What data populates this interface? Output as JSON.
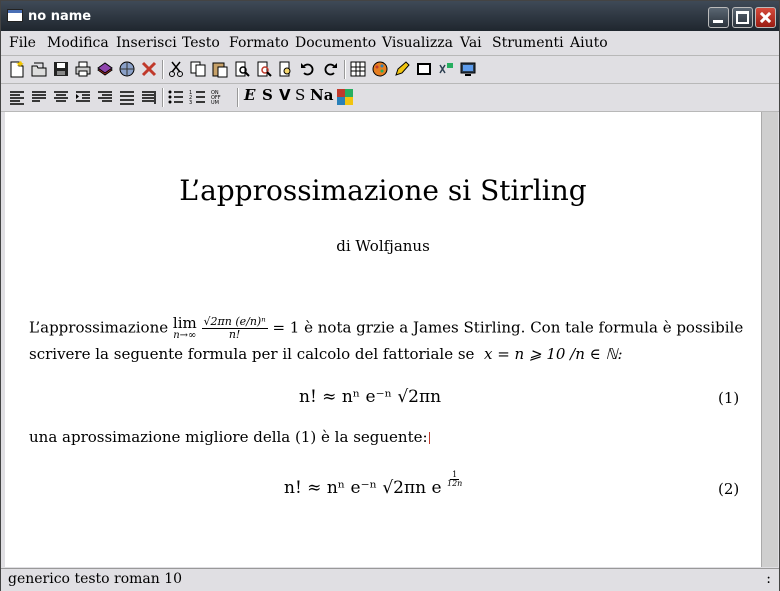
{
  "window": {
    "title": "no name"
  },
  "menu": [
    "File",
    "Modifica",
    "Inserisci",
    "Testo",
    "Formato",
    "Documento",
    "Visualizza",
    "Vai",
    "Strumenti",
    "Aiuto"
  ],
  "toolbar_icons": [
    "new-file-icon",
    "open-file-icon",
    "save-icon",
    "print-icon",
    "export-icon",
    "globe-icon",
    "close-doc-icon",
    "cut-icon",
    "copy-icon",
    "paste-icon",
    "find-icon",
    "replace-icon",
    "preview-icon",
    "undo-icon",
    "redo-icon",
    "table-icon",
    "paint-icon",
    "pen-icon",
    "frame-icon",
    "math-icon",
    "monitor-icon"
  ],
  "format_toolbar": {
    "emph": "E",
    "bold": "S",
    "sans": "V",
    "smallcaps": "S",
    "noun": "Na"
  },
  "document": {
    "title": "L’approssimazione si Stirling",
    "author": "di Wolfjanus",
    "para1_start": "L’approssimazione",
    "para1_lim": "lim",
    "para1_lim_sub": "n→∞",
    "para1_frac_num": "√2πn (e/n)ⁿ",
    "para1_frac_den": "n!",
    "para1_end": "= 1 è nota grzie a James Stirling. Con tale formula è possibile",
    "para2": "scrivere la seguente formula per il calcolo del fattoriale se",
    "para2_math": "x = n ⩾ 10 /n ∈ ℕ:",
    "eq1": "n! ≈ nⁿ e⁻ⁿ √2πn",
    "eq1_num": "(1)",
    "para3": "una aprossimazione migliore della (1) è la seguente:",
    "eq2": "n! ≈ nⁿ e⁻ⁿ √2πn e",
    "eq2_exp_num": "1",
    "eq2_exp_den": "12n",
    "eq2_num": "(2)"
  },
  "status": {
    "text": "generico testo roman 10",
    "right": ":"
  }
}
